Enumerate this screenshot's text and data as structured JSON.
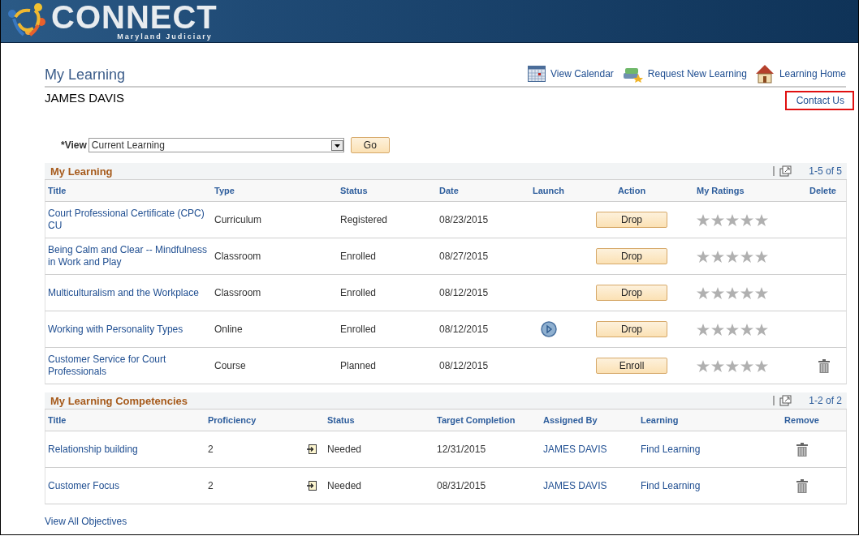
{
  "banner": {
    "title": "CONNECT",
    "subtitle": "Maryland Judiciary"
  },
  "page": {
    "title": "My Learning",
    "user": "JAMES DAVIS"
  },
  "links": [
    {
      "kind": "calendar",
      "label": "View Calendar"
    },
    {
      "kind": "books",
      "label": "Request New Learning"
    },
    {
      "kind": "home",
      "label": "Learning Home"
    }
  ],
  "contact": {
    "label": "Contact Us",
    "highlighted": true
  },
  "view": {
    "label": "*View",
    "value": "Current Learning",
    "button": "Go"
  },
  "learning": {
    "title": "My Learning",
    "count": "1-5 of 5",
    "columns": [
      "Title",
      "Type",
      "Status",
      "Date",
      "Launch",
      "Action",
      "My Ratings",
      "Delete"
    ],
    "rows": [
      {
        "title": "Court Professional Certificate (CPC) CU",
        "type": "Curriculum",
        "status": "Registered",
        "date": "08/23/2015",
        "launch": false,
        "action": "Drop",
        "stars": 0,
        "deletable": false
      },
      {
        "title": "Being Calm and Clear -- Mindfulness in Work and Play",
        "type": "Classroom",
        "status": "Enrolled",
        "date": "08/27/2015",
        "launch": false,
        "action": "Drop",
        "stars": 0,
        "deletable": false
      },
      {
        "title": "Multiculturalism and the Workplace",
        "type": "Classroom",
        "status": "Enrolled",
        "date": "08/12/2015",
        "launch": false,
        "action": "Drop",
        "stars": 0,
        "deletable": false
      },
      {
        "title": "Working with Personality Types",
        "type": "Online",
        "status": "Enrolled",
        "date": "08/12/2015",
        "launch": true,
        "action": "Drop",
        "stars": 0,
        "deletable": false
      },
      {
        "title": "Customer Service for Court Professionals",
        "type": "Course",
        "status": "Planned",
        "date": "08/12/2015",
        "launch": false,
        "action": "Enroll",
        "stars": 0,
        "deletable": true
      }
    ]
  },
  "competencies": {
    "title": "My Learning Competencies",
    "count": "1-2 of 2",
    "columns": [
      "Title",
      "Proficiency",
      "Status",
      "Target Completion",
      "Assigned By",
      "Learning",
      "Remove"
    ],
    "rows": [
      {
        "title": "Relationship building",
        "proficiency": "2",
        "status": "Needed",
        "target": "12/31/2015",
        "assigned_by": "JAMES DAVIS",
        "learning": "Find Learning"
      },
      {
        "title": "Customer Focus",
        "proficiency": "2",
        "status": "Needed",
        "target": "08/31/2015",
        "assigned_by": "JAMES DAVIS",
        "learning": "Find Learning"
      }
    ]
  },
  "footer_link": "View All Objectives"
}
